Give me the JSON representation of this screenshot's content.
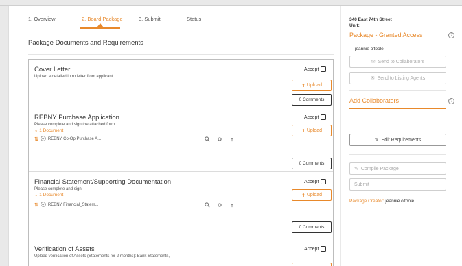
{
  "tabs": [
    {
      "label": "1. Overview",
      "active": false
    },
    {
      "label": "2. Board Package",
      "active": true
    },
    {
      "label": "3. Submit",
      "active": false
    },
    {
      "label": "Status",
      "active": false
    }
  ],
  "section_title": "Package Documents and Requirements",
  "documents": [
    {
      "title": "Cover Letter",
      "description": "Upload a detailed intro letter from applicant.",
      "accept_label": "Accept",
      "upload_label": "Upload",
      "comments_label": "0 Comments"
    },
    {
      "title": "REBNY Purchase Application",
      "description": "Please complete and sign the attached form.",
      "doc_count": "1 Document",
      "file_name": "REBNY Co-Op Purchase A...",
      "accept_label": "Accept",
      "upload_label": "Upload",
      "comments_label": "0 Comments"
    },
    {
      "title": "Financial Statement/Supporting Documentation",
      "description": "Please complete and sign.",
      "doc_count": "1 Document",
      "file_name": "REBNY Financial_Statem...",
      "accept_label": "Accept",
      "upload_label": "Upload",
      "comments_label": "0 Comments"
    },
    {
      "title": "Verification of Assets",
      "description": "Upload verification of Assets (Statements for 2 months): Bank Statements,",
      "accept_label": "Accept"
    }
  ],
  "sidebar": {
    "address": "340 East 74th Street",
    "unit_label": "Unit:",
    "granted_title": "Package - Granted Access",
    "granted_user": "jeannie o'toole",
    "send_collaborators": "Send to Collaborators",
    "send_agents": "Send to Listing Agents",
    "add_collaborators": "Add Collaborators",
    "edit_requirements": "Edit Requirements",
    "compile_package": "Compile Package",
    "submit": "Submit",
    "creator_label": "Package Creator:",
    "creator_name": "jeannie o'toole"
  },
  "colors": {
    "accent": "#e8892b",
    "text": "#333333",
    "border": "#bdbdbd"
  }
}
